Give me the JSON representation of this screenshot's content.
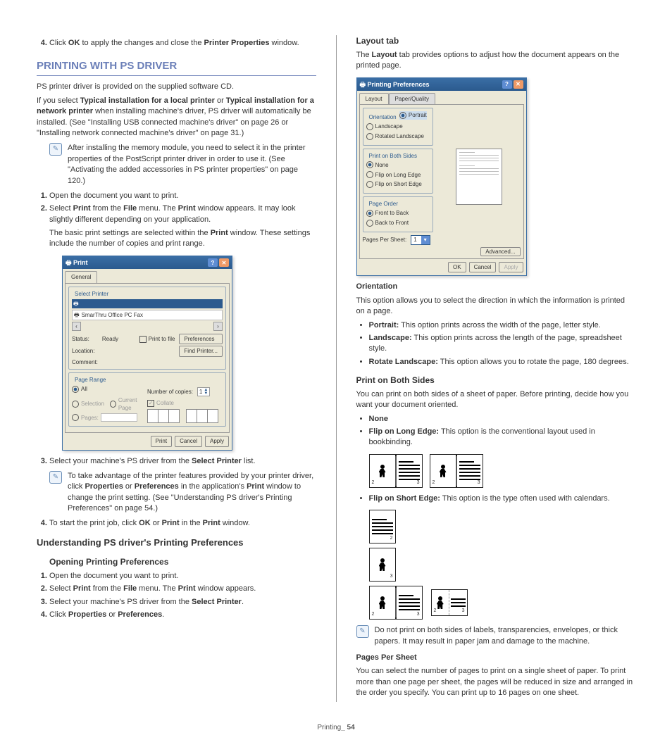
{
  "step4_left": {
    "num": "4.",
    "text_a": "Click ",
    "bold_a": "OK",
    "text_b": " to apply the changes and close the ",
    "bold_b": "Printer Properties",
    "text_c": " window."
  },
  "h1": "PRINTING WITH PS DRIVER",
  "p1": "PS printer driver is provided on the supplied software CD.",
  "p2_a": "If you select ",
  "p2_b1": "Typical installation for a local printer",
  "p2_c": " or ",
  "p2_b2": "Typical installation for a network printer",
  "p2_d": " when installing machine's driver, PS driver will automatically be installed. (See \"Installing USB connected machine's driver\" on page 26 or \"Installing network connected machine's driver\" on page 31.)",
  "note1": "After installing the memory module, you need to select it in the printer properties of the PostScript printer driver in order to use it. (See \"Activating the added accessories in PS printer properties\" on page 120.)",
  "ol1": {
    "i1": "Open the document you want to print.",
    "i2_a": "Select ",
    "i2_b1": "Print",
    "i2_c": " from the ",
    "i2_b2": "File",
    "i2_d": " menu. The ",
    "i2_b3": "Print",
    "i2_e": " window appears. It may look slightly different depending on your application.",
    "i2_sub_a": "The basic print settings are selected within the ",
    "i2_sub_b": "Print",
    "i2_sub_c": " window. These settings include the number of copies and print range."
  },
  "print_dialog": {
    "title": "Print",
    "tab": "General",
    "fs_select": "Select Printer",
    "printer": "SmarThru Office PC Fax",
    "status_lbl": "Status:",
    "status_val": "Ready",
    "location_lbl": "Location:",
    "comment_lbl": "Comment:",
    "print_to_file": "Print to file",
    "preferences": "Preferences",
    "find_printer": "Find Printer...",
    "fs_range": "Page Range",
    "r_all": "All",
    "r_sel": "Selection",
    "r_cur": "Current Page",
    "r_pages": "Pages:",
    "copies_lbl": "Number of copies:",
    "copies_val": "1",
    "collate": "Collate",
    "btn_print": "Print",
    "btn_cancel": "Cancel",
    "btn_apply": "Apply"
  },
  "ol1_i3_a": "Select your machine's PS driver from the ",
  "ol1_i3_b": "Select Printer",
  "ol1_i3_c": " list.",
  "note2_a": "To take advantage of the printer features provided by your printer driver, click ",
  "note2_b1": "Properties",
  "note2_c": " or ",
  "note2_b2": "Preferences",
  "note2_d": " in the application's ",
  "note2_b3": "Print",
  "note2_e": " window to change the print setting. (See \"Understanding PS driver's Printing Preferences\" on page 54.)",
  "ol1_i4_a": "To start the print job, click ",
  "ol1_i4_b1": "OK",
  "ol1_i4_c": " or ",
  "ol1_i4_b2": "Print",
  "ol1_i4_d": " in the ",
  "ol1_i4_b3": "Print",
  "ol1_i4_e": " window.",
  "h2": "Understanding PS driver's Printing Preferences",
  "h3_open": "Opening Printing Preferences",
  "ol2": {
    "i1": "Open the document you want to print.",
    "i2_a": "Select ",
    "i2_b1": "Print",
    "i2_c": " from the ",
    "i2_b2": "File",
    "i2_d": " menu. The ",
    "i2_b3": "Print",
    "i2_e": " window appears.",
    "i3_a": "Select your machine's PS driver from the ",
    "i3_b": "Select Printer",
    "i3_c": ".",
    "i4_a": "Click ",
    "i4_b1": "Properties",
    "i4_c": " or ",
    "i4_b2": "Preferences",
    "i4_d": "."
  },
  "h3_layout": "Layout tab",
  "layout_p_a": "The ",
  "layout_p_b": "Layout",
  "layout_p_c": " tab provides options to adjust how the document appears on the printed page.",
  "pref_dialog": {
    "title": "Printing Preferences",
    "tab1": "Layout",
    "tab2": "Paper/Quality",
    "fs_orient": "Orientation",
    "o_portrait": "Portrait",
    "o_landscape": "Landscape",
    "o_rotated": "Rotated Landscape",
    "fs_both": "Print on Both Sides",
    "b_none": "None",
    "b_long": "Flip on Long Edge",
    "b_short": "Flip on Short Edge",
    "fs_order": "Page Order",
    "po_ftb": "Front to Back",
    "po_btf": "Back to Front",
    "pps_lbl": "Pages Per Sheet:",
    "pps_val": "1",
    "advanced": "Advanced...",
    "btn_ok": "OK",
    "btn_cancel": "Cancel",
    "btn_apply": "Apply"
  },
  "h4_orient": "Orientation",
  "orient_p": "This option allows you to select the direction in which the information is printed on a page.",
  "orient_li": {
    "portrait_b": "Portrait:",
    "portrait_t": "  This option prints across the width of the page, letter style.",
    "landscape_b": "Landscape:",
    "landscape_t": "  This option prints across the length of the page, spreadsheet style.",
    "rotate_b": "Rotate Landscape:",
    "rotate_t": "  This option allows you to rotate the page, 180 degrees."
  },
  "h3_both": "Print on Both Sides",
  "both_p": "You can print on both sides of a sheet of paper. Before printing, decide how you want your document oriented.",
  "both_li": {
    "none_b": "None",
    "long_b": "Flip on Long Edge:",
    "long_t": "  This option is the conventional layout used in bookbinding.",
    "short_b": "Flip on Short Edge:",
    "short_t": "  This option is the type often used with calendars."
  },
  "note3": "Do not print on both sides of labels, transparencies, envelopes, or thick papers. It may result in paper jam and damage to the machine.",
  "h4_pps": "Pages Per Sheet",
  "pps_p": "You can select the number of pages to print on a single sheet of paper. To print more than one page per sheet, the pages will be reduced in size and arranged in the order you specify. You can print up to 16 pages on one sheet.",
  "footer_a": "Printing",
  "footer_b": "_ 54"
}
